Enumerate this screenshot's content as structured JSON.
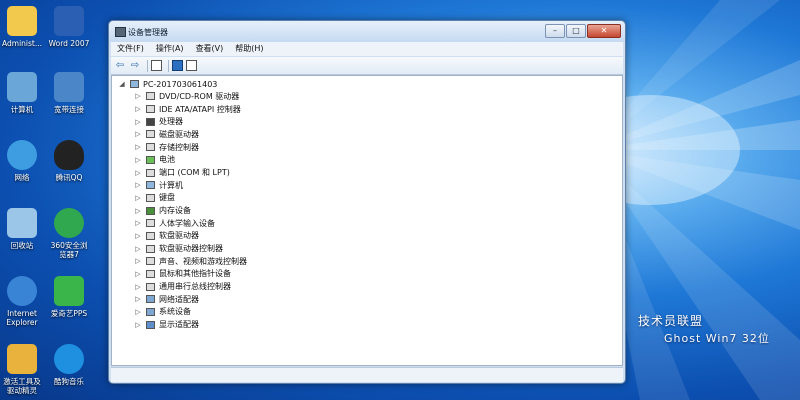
{
  "desktop": {
    "icons": [
      {
        "label": "Administ...",
        "color": "#f2c94c"
      },
      {
        "label": "Word 2007",
        "color": "#2b5fb3"
      },
      {
        "label": "计算机",
        "color": "#6aa7d8"
      },
      {
        "label": "宽带连接",
        "color": "#4a86c8"
      },
      {
        "label": "网络",
        "color": "#3e9de0"
      },
      {
        "label": "腾讯QQ",
        "color": "#222222"
      },
      {
        "label": "回收站",
        "color": "#9cc6e8"
      },
      {
        "label": "360安全浏览器7",
        "color": "#2fa84f"
      },
      {
        "label": "Internet Explorer",
        "color": "#3a84d6"
      },
      {
        "label": "爱奇艺PPS",
        "color": "#39b54a"
      },
      {
        "label": "激活工具及驱动精灵",
        "color": "#e8b23c"
      },
      {
        "label": "酷狗音乐",
        "color": "#1f8fe0"
      }
    ],
    "watermark_line1": "技术员联盟",
    "watermark_line2": "Ghost Win7 32位"
  },
  "window": {
    "title": "设备管理器",
    "buttons": {
      "minimize": "–",
      "maximize": "□",
      "close": "✕"
    },
    "menu": [
      "文件(F)",
      "操作(A)",
      "查看(V)",
      "帮助(H)"
    ],
    "toolbar": {
      "back": "⇦",
      "forward": "⇨"
    },
    "tree": {
      "root": "PC-201703061403",
      "items": [
        {
          "label": "DVD/CD-ROM 驱动器",
          "icon": "dvd-drive-icon"
        },
        {
          "label": "IDE ATA/ATAPI 控制器",
          "icon": "ide-controller-icon"
        },
        {
          "label": "处理器",
          "icon": "processor-icon"
        },
        {
          "label": "磁盘驱动器",
          "icon": "disk-drive-icon"
        },
        {
          "label": "存储控制器",
          "icon": "storage-controller-icon"
        },
        {
          "label": "电池",
          "icon": "battery-icon"
        },
        {
          "label": "端口 (COM 和 LPT)",
          "icon": "port-icon"
        },
        {
          "label": "计算机",
          "icon": "computer-icon"
        },
        {
          "label": "键盘",
          "icon": "keyboard-icon"
        },
        {
          "label": "内存设备",
          "icon": "memory-device-icon"
        },
        {
          "label": "人体学输入设备",
          "icon": "hid-icon"
        },
        {
          "label": "软盘驱动器",
          "icon": "floppy-drive-icon"
        },
        {
          "label": "软盘驱动器控制器",
          "icon": "floppy-controller-icon"
        },
        {
          "label": "声音、视频和游戏控制器",
          "icon": "sound-icon"
        },
        {
          "label": "鼠标和其他指针设备",
          "icon": "mouse-icon"
        },
        {
          "label": "通用串行总线控制器",
          "icon": "usb-icon"
        },
        {
          "label": "网络适配器",
          "icon": "network-adapter-icon"
        },
        {
          "label": "系统设备",
          "icon": "system-device-icon"
        },
        {
          "label": "显示适配器",
          "icon": "display-adapter-icon"
        }
      ]
    }
  }
}
